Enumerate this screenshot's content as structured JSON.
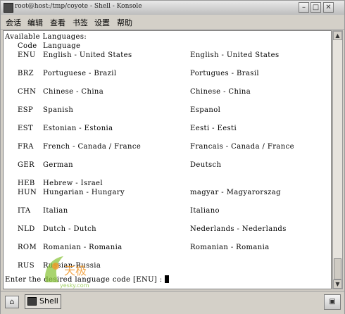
{
  "window": {
    "title": "root@host:/tmp/coyote - Shell - Konsole",
    "buttons": {
      "minimize": "–",
      "maximize": "□",
      "close": "✕"
    }
  },
  "menu": [
    "会话",
    "编辑",
    "查看",
    "书签",
    "设置",
    "帮助"
  ],
  "terminal": {
    "heading": "Available Languages:",
    "col_code": "Code",
    "col_language": "Language",
    "rows": [
      {
        "code": "ENU",
        "name": "English - United States",
        "native": "English - United States"
      },
      {
        "code": "BRZ",
        "name": "Portuguese - Brazil",
        "native": "Portugues - Brasil"
      },
      {
        "code": "CHN",
        "name": "Chinese - China",
        "native": "Chinese - China"
      },
      {
        "code": "ESP",
        "name": "Spanish",
        "native": "Espanol"
      },
      {
        "code": "EST",
        "name": "Estonian - Estonia",
        "native": "Eesti - Eesti"
      },
      {
        "code": "FRA",
        "name": "French - Canada / France",
        "native": "Francais - Canada / France"
      },
      {
        "code": "GER",
        "name": "German",
        "native": "Deutsch"
      },
      {
        "code": "HEB",
        "name": "Hebrew - Israel",
        "native": ""
      },
      {
        "code": "HUN",
        "name": "Hungarian - Hungary",
        "native": "magyar - Magyarorszag"
      },
      {
        "code": "ITA",
        "name": "Italian",
        "native": "Italiano"
      },
      {
        "code": "NLD",
        "name": "Dutch - Dutch",
        "native": "Nederlands - Nederlands"
      },
      {
        "code": "ROM",
        "name": "Romanian - Romania",
        "native": "Romanian - Romania"
      },
      {
        "code": "RUS",
        "name": "Russian-Russia",
        "native": ""
      }
    ],
    "prompt": "Enter the desired language code [ENU] :"
  },
  "taskbar": {
    "shell_label": "Shell"
  },
  "watermark": {
    "text": "天极",
    "subtext": "yesky.com"
  },
  "colors": {
    "window_bg": "#d4d0c8",
    "terminal_bg": "#ffffff",
    "terminal_fg": "#000000",
    "watermark_green": "#8cc63f",
    "watermark_orange": "#f39a2b"
  }
}
